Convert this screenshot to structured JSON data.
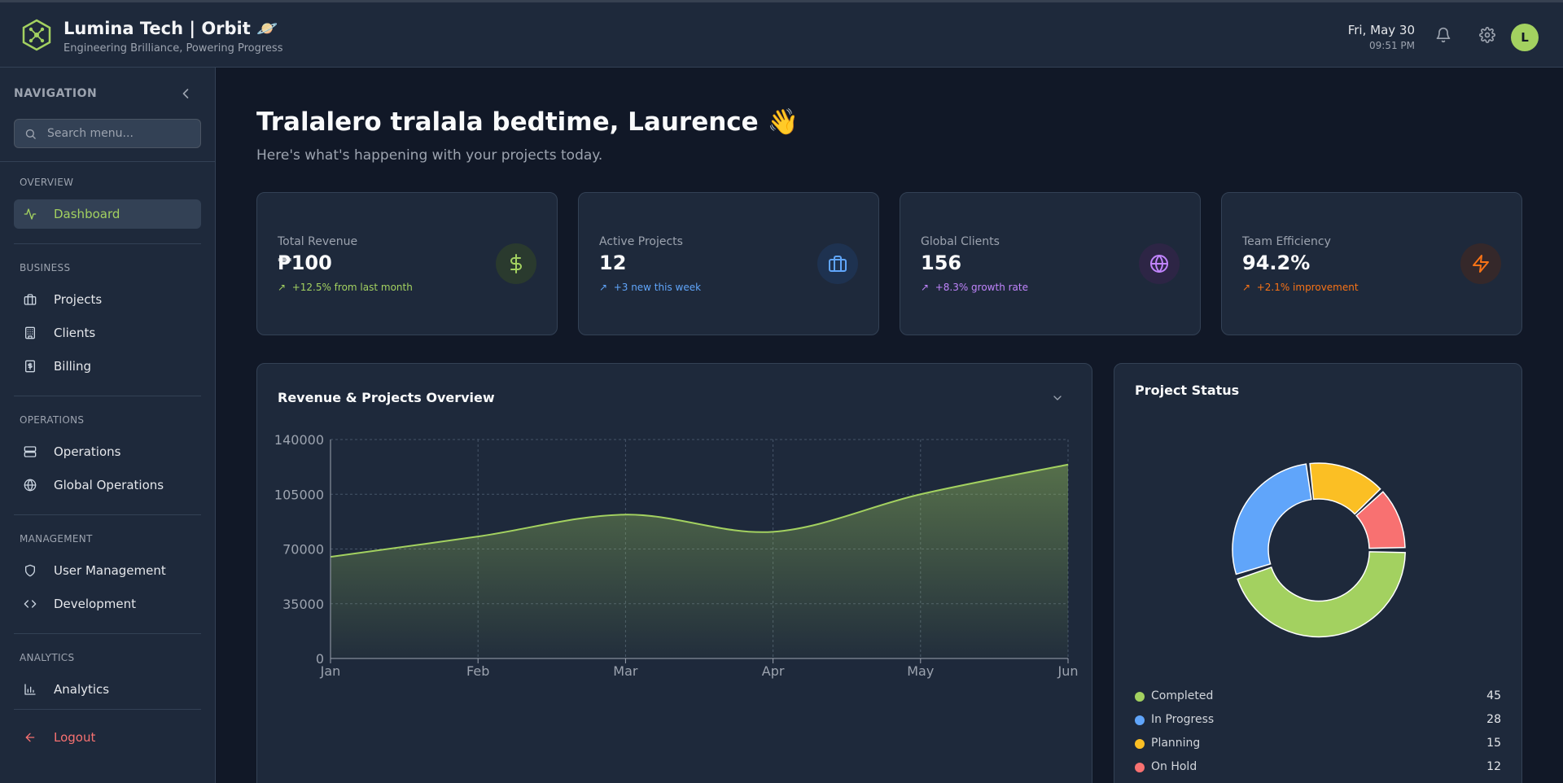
{
  "header": {
    "title": "Lumina Tech | Orbit 🪐",
    "subtitle": "Engineering Brilliance, Powering Progress",
    "date": "Fri, May 30",
    "time": "09:51 PM",
    "avatar_initial": "L"
  },
  "sidebar": {
    "title": "NAVIGATION",
    "search_placeholder": "Search menu...",
    "sections": {
      "overview": "OVERVIEW",
      "business": "BUSINESS",
      "operations": "OPERATIONS",
      "management": "MANAGEMENT",
      "analytics": "ANALYTICS"
    },
    "items": {
      "dashboard": "Dashboard",
      "projects": "Projects",
      "clients": "Clients",
      "billing": "Billing",
      "operations": "Operations",
      "global_operations": "Global Operations",
      "user_management": "User Management",
      "development": "Development",
      "analytics": "Analytics",
      "logout": "Logout"
    }
  },
  "main": {
    "greeting": "Tralalero tralala bedtime, Laurence 👋",
    "greeting_sub": "Here's what's happening with your projects today.",
    "stats": [
      {
        "label": "Total Revenue",
        "value": "₱100",
        "change": "+12.5% from last month",
        "color": "#a3d160",
        "icon": "dollar-icon"
      },
      {
        "label": "Active Projects",
        "value": "12",
        "change": "+3 new this week",
        "color": "#60a5fa",
        "icon": "briefcase-icon"
      },
      {
        "label": "Global Clients",
        "value": "156",
        "change": "+8.3% growth rate",
        "color": "#c084fc",
        "icon": "globe-icon"
      },
      {
        "label": "Team Efficiency",
        "value": "94.2%",
        "change": "+2.1% improvement",
        "color": "#f97316",
        "icon": "zap-icon"
      }
    ],
    "revenue_panel_title": "Revenue & Projects Overview",
    "status_panel_title": "Project Status"
  },
  "chart_data": [
    {
      "type": "area",
      "title": "Revenue & Projects Overview",
      "categories": [
        "Jan",
        "Feb",
        "Mar",
        "Apr",
        "May",
        "Jun"
      ],
      "series": [
        {
          "values": [
            65000,
            78000,
            92000,
            81000,
            105000,
            124000
          ],
          "color": "#a3d160"
        }
      ],
      "ylim": [
        0,
        140000
      ],
      "yticks": [
        0,
        35000,
        70000,
        105000,
        140000
      ],
      "grid": true
    },
    {
      "type": "pie",
      "title": "Project Status",
      "variant": "donut",
      "series": [
        {
          "name": "Completed",
          "value": 45,
          "color": "#a3d160"
        },
        {
          "name": "In Progress",
          "value": 28,
          "color": "#60a5fa"
        },
        {
          "name": "Planning",
          "value": 15,
          "color": "#fbbf24"
        },
        {
          "name": "On Hold",
          "value": 12,
          "color": "#f87171"
        }
      ]
    }
  ]
}
